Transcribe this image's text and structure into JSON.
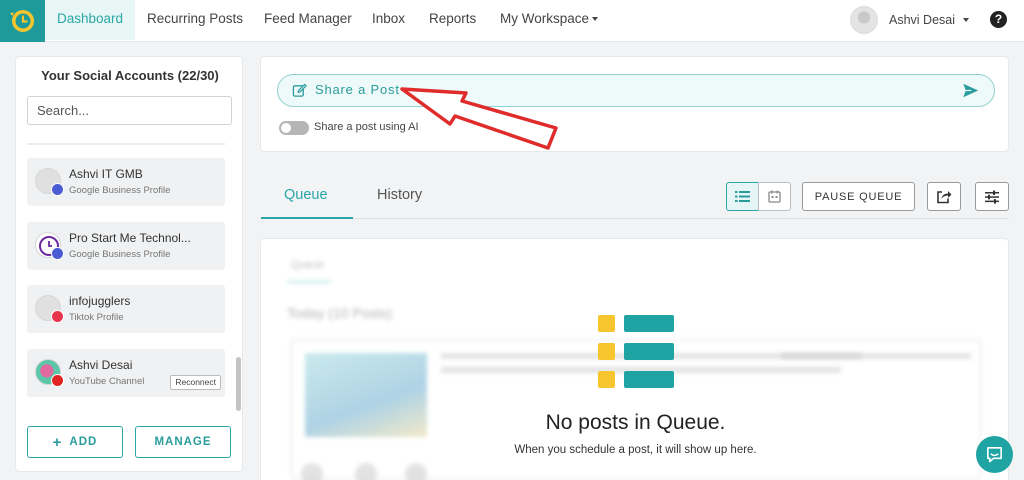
{
  "nav": {
    "items": [
      {
        "label": "Dashboard",
        "active": true
      },
      {
        "label": "Recurring Posts"
      },
      {
        "label": "Feed Manager"
      },
      {
        "label": "Inbox"
      },
      {
        "label": "Reports"
      },
      {
        "label": "My Workspace",
        "dropdown": true
      }
    ],
    "user_name": "Ashvi Desai",
    "help_glyph": "?"
  },
  "sidebar": {
    "title": "Your Social Accounts (22/30)",
    "search_placeholder": "Search...",
    "accounts": [
      {
        "name": "Ashvi IT GMB",
        "type": "Google Business Profile",
        "badge_icon": "google-business-icon",
        "badge_color": "#4a5bd4"
      },
      {
        "name": "Pro Start Me Technol...",
        "type": "Google Business Profile",
        "badge_icon": "google-business-icon",
        "badge_color": "#4a5bd4"
      },
      {
        "name": "infojugglers",
        "type": "Tiktok Profile",
        "badge_icon": "tiktok-icon",
        "badge_color": "#e8334d"
      },
      {
        "name": "Ashvi Desai",
        "type": "YouTube Channel",
        "badge_icon": "youtube-icon",
        "badge_color": "#e02424",
        "reconnect_label": "Reconnect"
      }
    ],
    "add_label": "ADD",
    "manage_label": "MANAGE"
  },
  "share": {
    "label": "Share a Post",
    "ai_toggle_label": "Share a post using AI",
    "ai_toggle_on": false
  },
  "tabs": [
    {
      "label": "Queue",
      "active": true
    },
    {
      "label": "History"
    }
  ],
  "toolbar": {
    "pause_label": "PAUSE QUEUE"
  },
  "queue": {
    "empty_title": "No posts in Queue.",
    "empty_subtitle": "When you schedule a post, it will show up here.",
    "ghost_tab": "Queue",
    "ghost_heading": "Today (10 Posts)"
  },
  "colors": {
    "brand": "#1f9a9a",
    "accent": "#2aa6a6",
    "annotation_arrow": "#e02b2b",
    "illustration_yellow": "#f7c62f",
    "illustration_teal": "#20a3a3"
  }
}
